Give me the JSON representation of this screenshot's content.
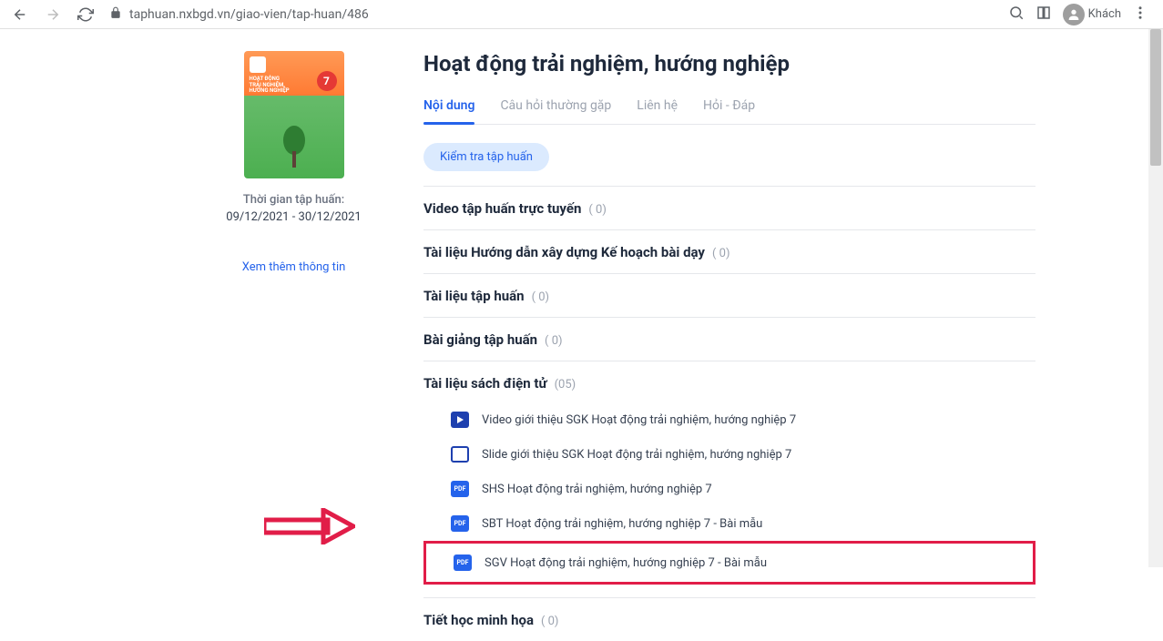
{
  "browser": {
    "url": "taphuan.nxbgd.vn/giao-vien/tap-huan/486",
    "guest_label": "Khách"
  },
  "sidebar": {
    "cover_line1": "HOẠT ĐỘNG",
    "cover_line2": "TRẢI NGHIỆM,",
    "cover_line3": "HƯỚNG NGHIỆP",
    "cover_grade": "7",
    "time_label": "Thời gian tập huấn:",
    "time_value": "09/12/2021 - 30/12/2021",
    "more_info": "Xem thêm thông tin"
  },
  "main": {
    "title": "Hoạt động trải nghiệm, hướng nghiệp",
    "tabs": [
      {
        "label": "Nội dung"
      },
      {
        "label": "Câu hỏi thường gặp"
      },
      {
        "label": "Liên hệ"
      },
      {
        "label": "Hỏi - Đáp"
      }
    ],
    "check_btn": "Kiểm tra tập huấn",
    "sections": [
      {
        "title": "Video tập huấn trực tuyến",
        "count": "( 0)"
      },
      {
        "title": "Tài liệu Hướng dẫn xây dựng Kế hoạch bài dạy",
        "count": "( 0)"
      },
      {
        "title": "Tài liệu tập huấn",
        "count": "( 0)"
      },
      {
        "title": "Bài giảng tập huấn",
        "count": "( 0)"
      },
      {
        "title": "Tài liệu sách điện tử",
        "count": "(05)"
      },
      {
        "title": "Tiết học minh họa",
        "count": "( 0)"
      }
    ],
    "docs": [
      {
        "type": "video",
        "name": "Video giới thiệu SGK Hoạt động trải nghiệm, hướng nghiệp 7"
      },
      {
        "type": "slide",
        "name": "Slide giới thiệu SGK Hoạt động trải nghiệm, hướng nghiệp 7"
      },
      {
        "type": "pdf",
        "name": "SHS Hoạt động trải nghiệm, hướng nghiệp 7"
      },
      {
        "type": "pdf",
        "name": "SBT Hoạt động trải nghiệm, hướng nghiệp 7 - Bài mẫu"
      },
      {
        "type": "pdf",
        "name": "SGV Hoạt động trải nghiệm, hướng nghiệp 7 - Bài mẫu"
      }
    ],
    "pdf_label": "PDF"
  }
}
